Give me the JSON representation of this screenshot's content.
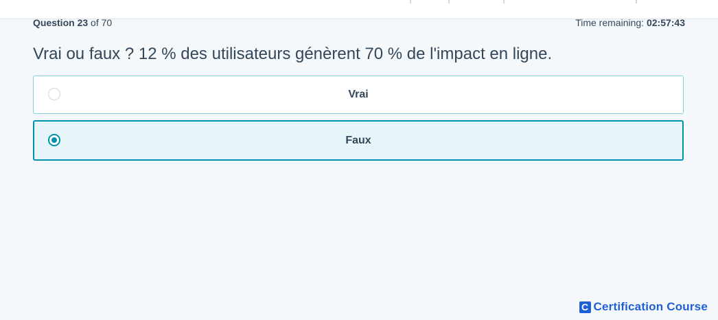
{
  "header": {
    "question_label": "Question",
    "question_current": "23",
    "question_of": "of 70",
    "time_label": "Time remaining:",
    "time_value": "02:57:43"
  },
  "question": {
    "text": "Vrai ou faux ? 12 % des utilisateurs génèrent 70 % de l'impact en ligne."
  },
  "options": [
    {
      "label": "Vrai",
      "selected": false
    },
    {
      "label": "Faux",
      "selected": true
    }
  ],
  "brand": {
    "logo_letter": "C",
    "name": "Certification Course"
  },
  "colors": {
    "accent": "#0091ae",
    "selected_bg": "#e5f5f8",
    "option_border": "#7fd1de",
    "brand_blue": "#1f5fd6",
    "text": "#33475b",
    "page_bg": "#f5f8fa"
  }
}
